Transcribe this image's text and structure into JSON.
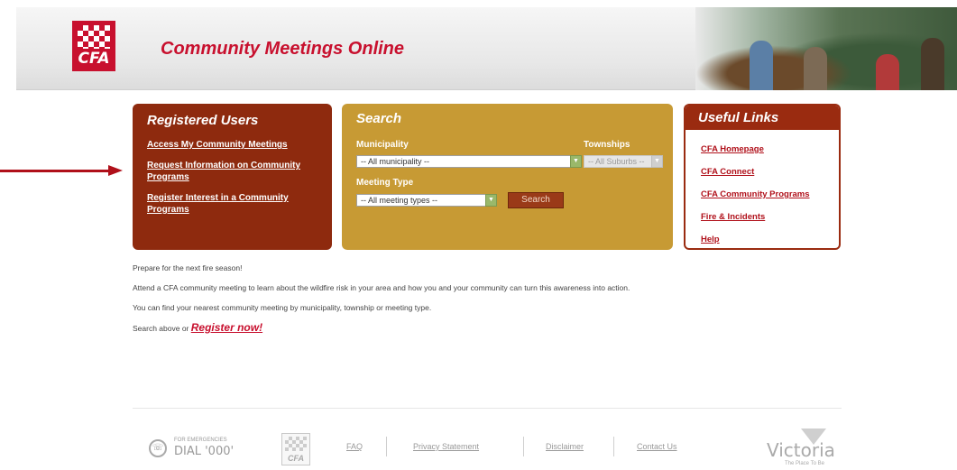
{
  "header": {
    "logo_text": "CFA",
    "site_title": "Community Meetings Online"
  },
  "registered_users": {
    "title": "Registered Users",
    "links": [
      "Access My Community Meetings",
      "Request Information on Community Programs",
      "Register Interest in a Community Programs"
    ]
  },
  "search": {
    "title": "Search",
    "municipality_label": "Municipality",
    "municipality_value": "-- All municipality --",
    "townships_label": "Townships",
    "townships_value": "-- All Suburbs --",
    "meeting_type_label": "Meeting Type",
    "meeting_type_value": "-- All meeting types --",
    "search_button": "Search"
  },
  "useful_links": {
    "title": "Useful Links",
    "links": [
      "CFA Homepage",
      "CFA Connect",
      "CFA Community Programs",
      "Fire & Incidents",
      "Help"
    ]
  },
  "content": {
    "p1": "Prepare for the next fire season!",
    "p2": "Attend a CFA community meeting to learn about the wildfire risk in your area and how you and your community can turn this awareness into action.",
    "p3": "You can find your nearest community meeting by municipality, township or meeting type.",
    "p4_prefix": "Search above or",
    "register_link": "Register now!"
  },
  "footer": {
    "emergency_small": "FOR EMERGENCIES",
    "emergency_big": "DIAL '000'",
    "logo_text": "CFA",
    "links": [
      "FAQ",
      "Privacy Statement",
      "Disclaimer",
      "Contact Us"
    ],
    "victoria": "Victoria",
    "victoria_tagline": "The Place To Be"
  },
  "colors": {
    "brand_red": "#c8102e",
    "registered_panel": "#8e2a0e",
    "search_panel": "#c79a34",
    "links_border": "#9a2b10"
  }
}
